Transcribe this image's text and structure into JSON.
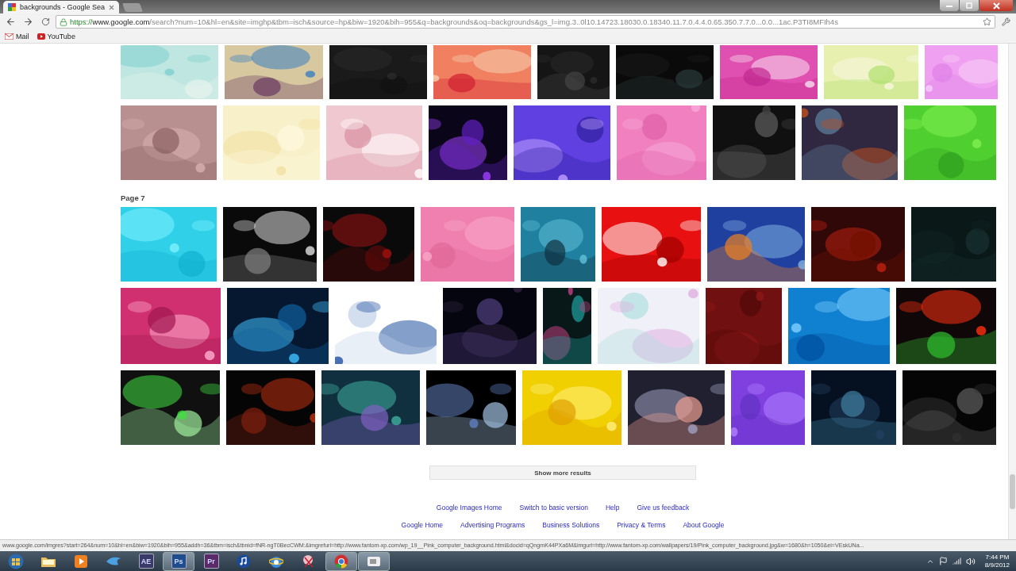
{
  "browser": {
    "tab": {
      "title": "backgrounds - Google Sea",
      "selected": true
    },
    "address": {
      "scheme": "https://",
      "host": "www.google.com",
      "path": "/search?num=10&hl=en&site=imghp&tbm=isch&source=hp&biw=1920&bih=955&q=backgrounds&oq=backgrounds&gs_l=img.3..0l10.14723.18030.0.18340.11.7.0.4.4.0.65.350.7.7.0...0.0...1ac.P3TI8MFIh4s"
    },
    "bookmarks": [
      {
        "kind": "mail",
        "label": "Mail"
      },
      {
        "kind": "youtube",
        "label": "YouTube"
      }
    ]
  },
  "results": {
    "page_label": "Page 7",
    "show_more": "Show more results"
  },
  "footer": {
    "links_row_1": [
      "Google Images Home",
      "Switch to basic version",
      "Help",
      "Give us feedback"
    ],
    "links_row_2": [
      "Google Home",
      "Advertising Programs",
      "Business Solutions",
      "Privacy & Terms",
      "About Google"
    ]
  },
  "status_bar": "www.google.com/imgres?start=264&num=10&hl=en&biw=1920&bih=955&addh=36&tbm=isch&tbnid=fNR-ngT0BecCWM:&imgrefurl=http://www.fantom-xp.com/wp_19__Pink_computer_background.html&docid=qQngmK44PXa6M&imgurl=http://www.fantom-xp.com/wallpapers/19/Pink_computer_background.jpg&w=1680&h=1050&ei=VEskUNa...",
  "taskbar": {
    "apps": [
      {
        "kind": "start",
        "open": false
      },
      {
        "kind": "folder",
        "open": false
      },
      {
        "kind": "media",
        "open": false
      },
      {
        "kind": "bird",
        "open": false
      },
      {
        "kind": "tile",
        "label": "AE",
        "color": "#3a3a6a",
        "open": false
      },
      {
        "kind": "tile",
        "label": "Ps",
        "color": "#1d4d8c",
        "open": true
      },
      {
        "kind": "tile",
        "label": "Pr",
        "color": "#5a2a6a",
        "open": false
      },
      {
        "kind": "music",
        "open": false
      },
      {
        "kind": "ie",
        "open": false
      },
      {
        "kind": "snip",
        "open": false
      },
      {
        "kind": "chrome",
        "open": true
      },
      {
        "kind": "video",
        "open": true
      }
    ],
    "time": "7:44 PM",
    "date": "8/9/2012"
  }
}
